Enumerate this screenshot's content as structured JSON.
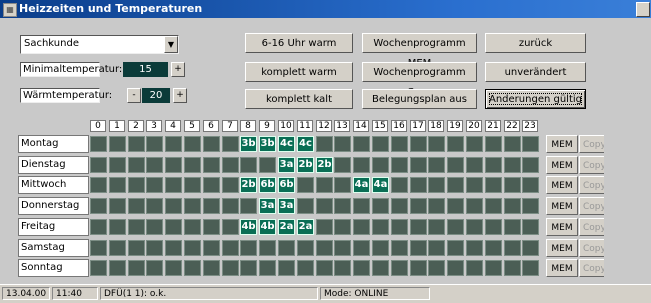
{
  "window": {
    "title": "Heizzeiten und Temperaturen"
  },
  "room_select": {
    "value": "Sachkunde"
  },
  "min_temp": {
    "label": "Minimaltemperatur:",
    "value": "15",
    "inc": "+"
  },
  "comfort_temp": {
    "label": "Wärmtemperatur:",
    "value": "20",
    "dec": "-",
    "inc": "+"
  },
  "buttons": {
    "warm_6_16": "6-16 Uhr warm",
    "weekprog_mem": "Wochenprogramm MEM",
    "back": "zurück",
    "all_warm": "komplett warm",
    "weekprog_copy": "Wochenprogramm Copy",
    "unchanged": "unverändert",
    "all_cold": "komplett kalt",
    "occupancy_off": "Belegungsplan aus",
    "apply": "Änderungen gültig"
  },
  "schedule": {
    "hours": [
      "0",
      "1",
      "2",
      "3",
      "4",
      "5",
      "6",
      "7",
      "8",
      "9",
      "10",
      "11",
      "12",
      "13",
      "14",
      "15",
      "16",
      "17",
      "18",
      "19",
      "20",
      "21",
      "22",
      "23"
    ],
    "mem_label": "MEM",
    "copy_label": "Copy",
    "days": [
      {
        "name": "Montag",
        "cells": {
          "8": "3b",
          "9": "3b",
          "10": "4c",
          "11": "4c"
        }
      },
      {
        "name": "Dienstag",
        "cells": {
          "10": "3a",
          "11": "2b",
          "12": "2b"
        }
      },
      {
        "name": "Mittwoch",
        "cells": {
          "8": "2b",
          "9": "6b",
          "10": "6b",
          "14": "4a",
          "15": "4a"
        }
      },
      {
        "name": "Donnerstag",
        "cells": {
          "9": "3a",
          "10": "3a"
        }
      },
      {
        "name": "Freitag",
        "cells": {
          "8": "4b",
          "9": "4b",
          "10": "2a",
          "11": "2a"
        }
      },
      {
        "name": "Samstag",
        "cells": {}
      },
      {
        "name": "Sonntag",
        "cells": {}
      }
    ]
  },
  "status": {
    "date": "13.04.00",
    "time": "11:40",
    "dfue": "DFÜ(1 1): o.k.",
    "mode": "Mode: ONLINE"
  }
}
